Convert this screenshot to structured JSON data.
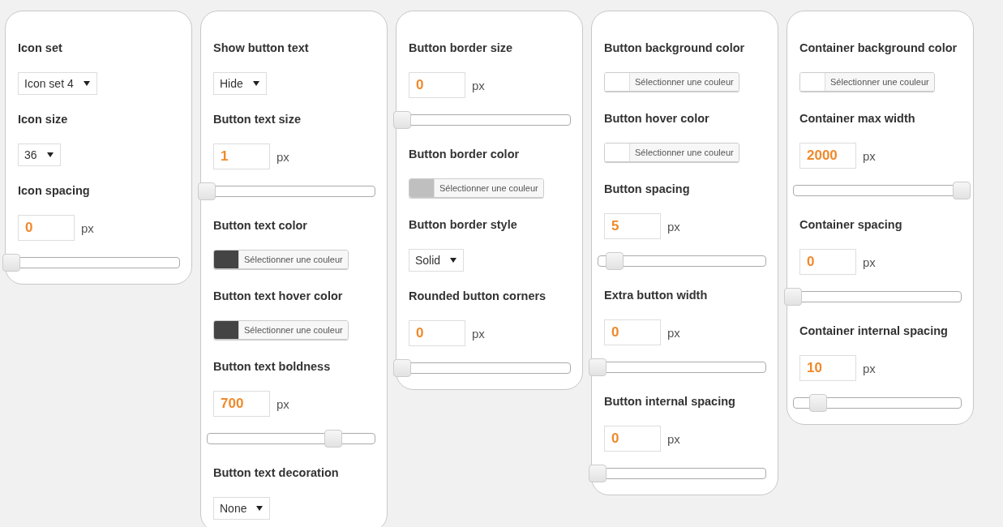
{
  "panels": [
    {
      "settings": [
        {
          "kind": "select",
          "label": "Icon set",
          "value": "Icon set 4"
        },
        {
          "kind": "select",
          "label": "Icon size",
          "value": "36"
        },
        {
          "kind": "number",
          "label": "Icon spacing",
          "value": "0",
          "unit": "px",
          "level": 0
        }
      ]
    },
    {
      "settings": [
        {
          "kind": "select",
          "label": "Show button text",
          "value": "Hide"
        },
        {
          "kind": "number",
          "label": "Button text size",
          "value": "1",
          "unit": "px",
          "level": 0
        },
        {
          "kind": "color",
          "label": "Button text color",
          "button": "Sélectionner une couleur",
          "color": "#444444"
        },
        {
          "kind": "color",
          "label": "Button text hover color",
          "button": "Sélectionner une couleur",
          "color": "#444444"
        },
        {
          "kind": "number",
          "label": "Button text boldness",
          "value": "700",
          "unit": "px",
          "level": 0.75
        },
        {
          "kind": "select",
          "label": "Button text decoration",
          "value": "None"
        }
      ]
    },
    {
      "settings": [
        {
          "kind": "number",
          "label": "Button border size",
          "value": "0",
          "unit": "px",
          "level": 0
        },
        {
          "kind": "color",
          "label": "Button border color",
          "button": "Sélectionner une couleur",
          "color": "#bfbfbf"
        },
        {
          "kind": "select",
          "label": "Button border style",
          "value": "Solid"
        },
        {
          "kind": "number",
          "label": "Rounded button corners",
          "value": "0",
          "unit": "px",
          "level": 0
        }
      ]
    },
    {
      "settings": [
        {
          "kind": "color",
          "label": "Button background color",
          "button": "Sélectionner une couleur",
          "color": "#ffffff"
        },
        {
          "kind": "color",
          "label": "Button hover color",
          "button": "Sélectionner une couleur",
          "color": "#ffffff"
        },
        {
          "kind": "number",
          "label": "Button spacing",
          "value": "5",
          "unit": "px",
          "level": 0.1
        },
        {
          "kind": "number",
          "label": "Extra button width",
          "value": "0",
          "unit": "px",
          "level": 0
        },
        {
          "kind": "number",
          "label": "Button internal spacing",
          "value": "0",
          "unit": "px",
          "level": 0
        }
      ]
    },
    {
      "settings": [
        {
          "kind": "color",
          "label": "Container background color",
          "button": "Sélectionner une couleur",
          "color": "#ffffff"
        },
        {
          "kind": "number",
          "label": "Container max width",
          "value": "2000",
          "unit": "px",
          "level": 1
        },
        {
          "kind": "number",
          "label": "Container spacing",
          "value": "0",
          "unit": "px",
          "level": 0
        },
        {
          "kind": "number",
          "label": "Container internal spacing",
          "value": "10",
          "unit": "px",
          "level": 0.15
        }
      ]
    }
  ]
}
